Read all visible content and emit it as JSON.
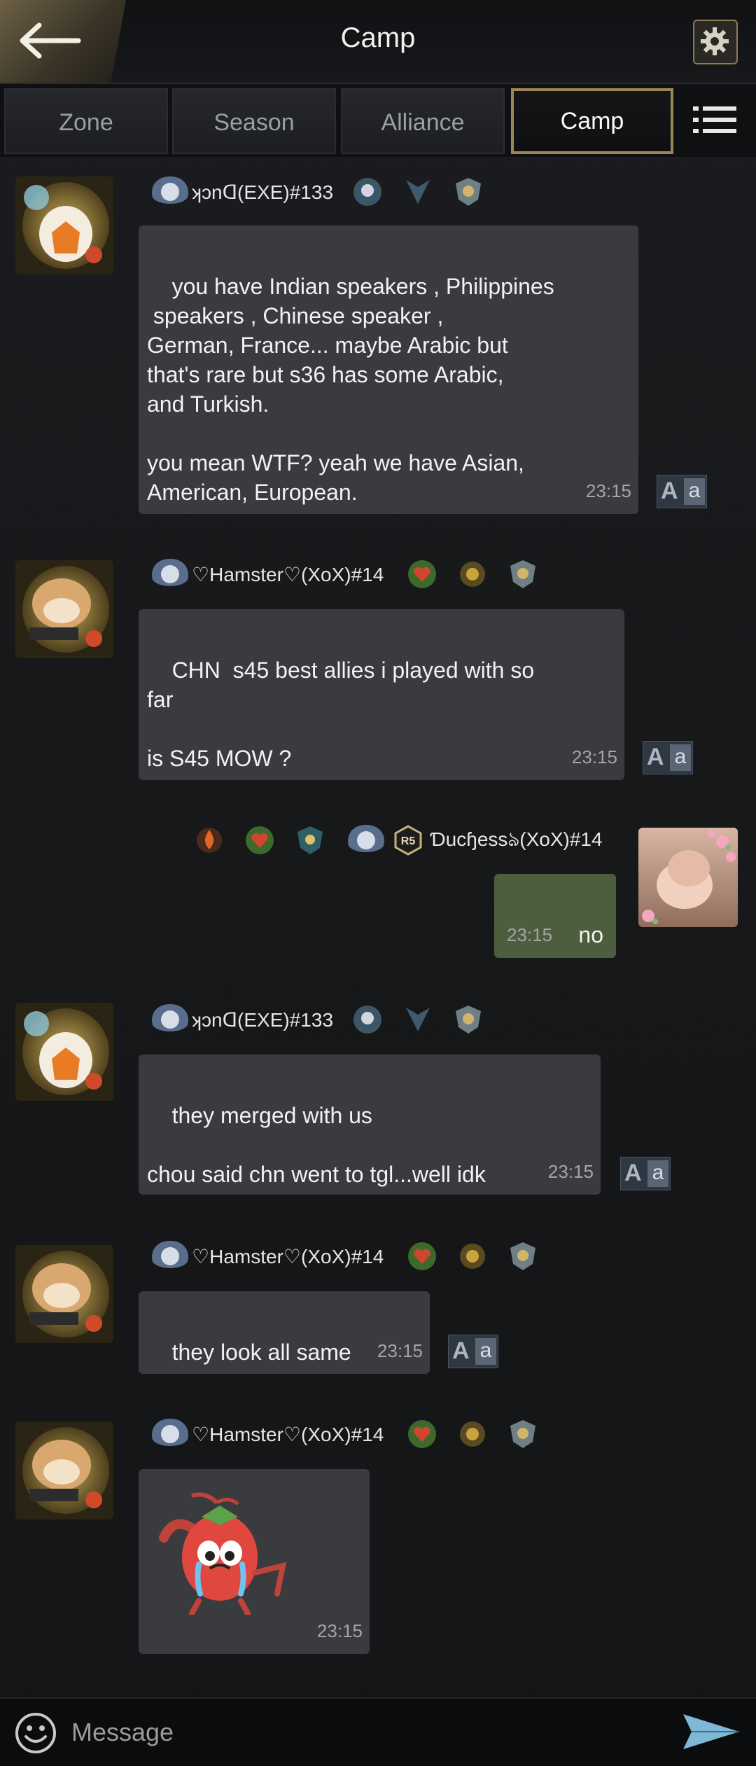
{
  "header": {
    "title": "Camp"
  },
  "tabs": [
    {
      "label": "Zone"
    },
    {
      "label": "Season"
    },
    {
      "label": "Alliance"
    },
    {
      "label": "Camp",
      "active": true
    }
  ],
  "messages": [
    {
      "sender": "ʞɔnᗡ(EXE)#133",
      "text": "you have Indian speakers , Philippines\n speakers , Chinese speaker ,\nGerman, France... maybe Arabic but\nthat's rare but s36 has some Arabic,\nand Turkish.\n\nyou mean WTF? yeah we have Asian,\nAmerican, European.",
      "time": "23:15"
    },
    {
      "sender": "♡Hamster♡(XoX)#14",
      "text": "CHN  s45 best allies i played with so\nfar\n\nis S45 MOW ?",
      "time": "23:15"
    },
    {
      "sender": "Ɗucɧessঌ(XoX)#14",
      "rank": "R5",
      "text": "no",
      "time": "23:15"
    },
    {
      "sender": "ʞɔnᗡ(EXE)#133",
      "text": "they merged with us\n\nchou said chn went to tgl...well idk",
      "time": "23:15"
    },
    {
      "sender": "♡Hamster♡(XoX)#14",
      "text": "they look all same",
      "time": "23:15"
    },
    {
      "sender": "♡Hamster♡(XoX)#14",
      "sticker": "crying-strawberry-sticker",
      "time": "23:15"
    }
  ],
  "translate_button": {
    "big": "A",
    "small": "a"
  },
  "composer": {
    "placeholder": "Message"
  },
  "colors": {
    "accent": "#9c8658",
    "bubble": "#3a3b3e",
    "own_bubble": "#4d5e3e"
  }
}
